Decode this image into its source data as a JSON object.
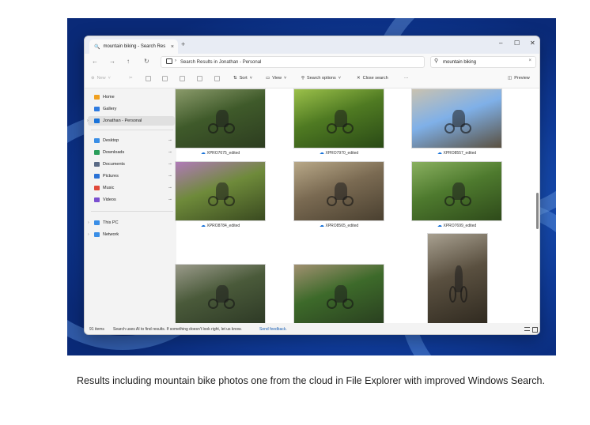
{
  "window": {
    "tab_title": "mountain biking - Search Res",
    "tab_close": "×",
    "new_tab": "+",
    "controls": {
      "minimize": "–",
      "maximize": "☐",
      "close": "✕"
    }
  },
  "navigation": {
    "back": "←",
    "forward": "→",
    "up": "↑",
    "refresh": "↻",
    "address": "Search Results in Jonathan - Personal",
    "address_chevron": "›",
    "search_value": "mountain biking",
    "search_clear": "×"
  },
  "toolbar": {
    "new_label": "New",
    "sort_label": "Sort",
    "view_label": "View",
    "search_options_label": "Search options",
    "close_search_label": "Close search",
    "more_label": "···",
    "preview_label": "Preview"
  },
  "sidebar": {
    "items": [
      {
        "label": "Home",
        "icon": "home-icon",
        "color": "#f0a020"
      },
      {
        "label": "Gallery",
        "icon": "gallery-icon",
        "color": "#2f7be0"
      },
      {
        "label": "Jonathan - Personal",
        "icon": "cloud-icon",
        "color": "#1a73d9",
        "selected": true
      },
      {
        "label": "Desktop",
        "icon": "desktop-icon",
        "color": "#3a8ee6",
        "pinned": true
      },
      {
        "label": "Downloads",
        "icon": "download-icon",
        "color": "#2a9d5a",
        "pinned": true
      },
      {
        "label": "Documents",
        "icon": "documents-icon",
        "color": "#5a6a85",
        "pinned": true
      },
      {
        "label": "Pictures",
        "icon": "pictures-icon",
        "color": "#2a72d6",
        "pinned": true
      },
      {
        "label": "Music",
        "icon": "music-icon",
        "color": "#e0493a",
        "pinned": true
      },
      {
        "label": "Videos",
        "icon": "videos-icon",
        "color": "#7a4fd0",
        "pinned": true
      },
      {
        "label": "This PC",
        "icon": "pc-icon",
        "color": "#3a8ee6"
      },
      {
        "label": "Network",
        "icon": "network-icon",
        "color": "#3a8ee6"
      }
    ]
  },
  "results": [
    {
      "name": "XPRO7675_edited",
      "colors": [
        "#3f5a2a",
        "#8a9a6a",
        "#2d3d20"
      ]
    },
    {
      "name": "XPRO7970_edited",
      "colors": [
        "#4f7a22",
        "#9bc04a",
        "#2a4a16"
      ]
    },
    {
      "name": "XPRO8557_edited",
      "colors": [
        "#7fb0e8",
        "#c9c2b0",
        "#5a5040"
      ]
    },
    {
      "name": "XPRO8784_edited",
      "colors": [
        "#6e8a3a",
        "#b07ab8",
        "#3a4a20"
      ]
    },
    {
      "name": "XPRO8565_edited",
      "colors": [
        "#7a6a52",
        "#b8a888",
        "#4a4030"
      ]
    },
    {
      "name": "XPRO7699_edited",
      "colors": [
        "#4e7a2e",
        "#8ab060",
        "#2e4a1a"
      ]
    },
    {
      "name": "",
      "colors": [
        "#4a5a3a",
        "#9a9a8a",
        "#2e3a26"
      ]
    },
    {
      "name": "",
      "colors": [
        "#3d6a2a",
        "#a09070",
        "#2a4020"
      ]
    },
    {
      "name": "",
      "colors": [
        "#5a5040",
        "#a8a090",
        "#302a20"
      ]
    }
  ],
  "status": {
    "count": "91 items",
    "message": "Search uses AI to find results. If something doesn't look right, let us know.",
    "link": "Send feedback."
  },
  "figure_caption": "Results including mountain bike photos one from the cloud in File Explorer with improved Windows Search."
}
